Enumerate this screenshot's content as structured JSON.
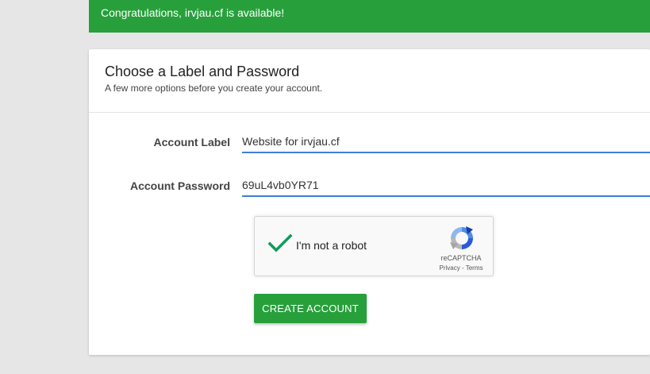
{
  "banner": {
    "message": "Congratulations, irvjau.cf is available!",
    "color": "#27a03b"
  },
  "card": {
    "title": "Choose a Label and Password",
    "subtitle": "A few more options before you create your account."
  },
  "form": {
    "account_label": {
      "label": "Account Label",
      "value": "Website for irvjau.cf"
    },
    "account_password": {
      "label": "Account Password",
      "value": "69uL4vb0YR71"
    },
    "input_underline_color": "#3b7fd9"
  },
  "recaptcha": {
    "checkbox_label": "I'm not a robot",
    "checked": true,
    "brand": "reCAPTCHA",
    "privacy_link": "Privacy",
    "separator": " - ",
    "terms_link": "Terms",
    "check_color": "#0f9d58"
  },
  "actions": {
    "create_account_label": "CREATE ACCOUNT",
    "button_color": "#27a03b"
  }
}
